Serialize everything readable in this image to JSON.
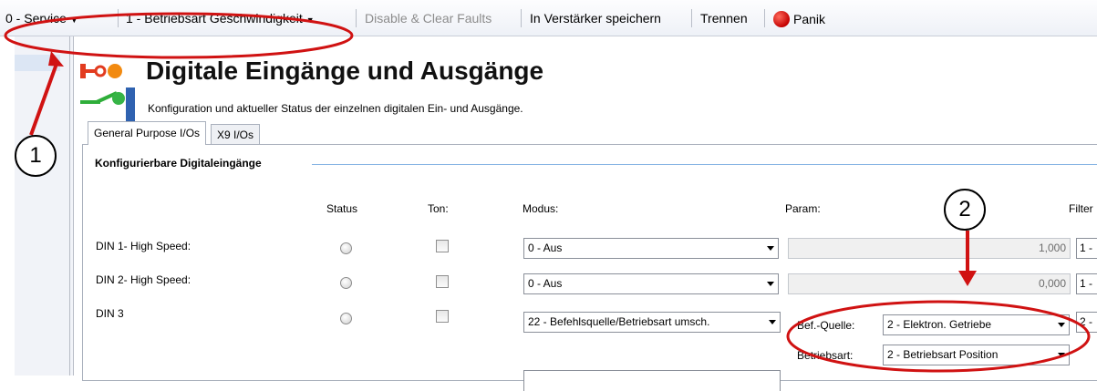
{
  "toolbar": {
    "service": "0 - Service",
    "betriebsart": "1 - Betriebsart Geschwindigkeit",
    "disable_clear": "Disable & Clear Faults",
    "save": "In Verstärker speichern",
    "trennen": "Trennen",
    "panik": "Panik"
  },
  "header": {
    "title": "Digitale Eingänge und Ausgänge",
    "subtitle": "Konfiguration und aktueller Status der einzelnen digitalen Ein- und Ausgänge."
  },
  "tabs": [
    {
      "label": "General Purpose I/Os",
      "active": true
    },
    {
      "label": "X9 I/Os",
      "active": false
    }
  ],
  "group": {
    "title": "Konfigurierbare Digitaleingänge"
  },
  "columns": {
    "status": "Status",
    "ton": "Ton:",
    "modus": "Modus:",
    "param": "Param:",
    "filter": "Filter"
  },
  "rows": [
    {
      "label": "DIN 1- High Speed:",
      "modus": "0 - Aus",
      "param": "1,000",
      "filter": "1 -"
    },
    {
      "label": "DIN 2- High Speed:",
      "modus": "0 - Aus",
      "param": "0,000",
      "filter": "1 -"
    },
    {
      "label": "DIN 3",
      "modus": "22 - Befehlsquelle/Betriebsart umsch.",
      "filter": "2 -",
      "sub": [
        {
          "label": "Bef.-Quelle:",
          "value": "2 - Elektron. Getriebe"
        },
        {
          "label": "Betriebsart:",
          "value": "2 - Betriebsart Position"
        }
      ]
    }
  ],
  "annotations": {
    "one": "1",
    "two": "2"
  },
  "colors": {
    "annotation": "#d01212",
    "accent_line": "#86b4e4"
  }
}
